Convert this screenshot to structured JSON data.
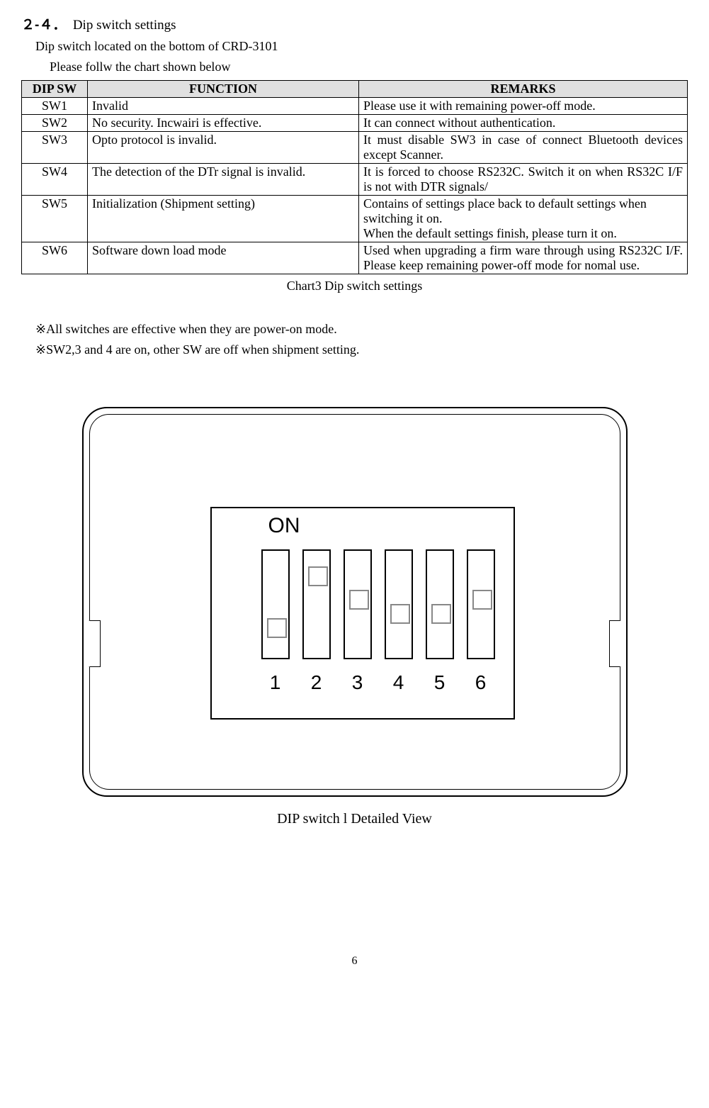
{
  "heading": {
    "number": "２-４．",
    "title": "Dip switch settings"
  },
  "intro_line1": "Dip switch   located on the bottom of CRD-3101",
  "intro_line2": "Please follw the chart shown below",
  "table": {
    "headers": {
      "sw": "DIP SW",
      "func": "FUNCTION",
      "rem": "REMARKS"
    },
    "rows": [
      {
        "sw": "SW1",
        "func": "Invalid",
        "rem": "Please use it with remaining power-off mode."
      },
      {
        "sw": "SW2",
        "func": "No security. Incwairi is effective.",
        "rem": "It can connect without authentication."
      },
      {
        "sw": "SW3",
        "func": "Opto protocol is invalid.",
        "rem": "It must disable SW3 in case of connect Bluetooth devices except Scanner."
      },
      {
        "sw": "SW4",
        "func": "The detection of the DTr signal is invalid.",
        "rem": "It is forced to choose RS232C. Switch it on when RS32C I/F is not with DTR signals/"
      },
      {
        "sw": "SW5",
        "func": "Initialization (Shipment setting)",
        "rem": "Contains of settings place back to default settings when switching it on.\nWhen the default settings finish, please turn it on."
      },
      {
        "sw": "SW6",
        "func": "Software down load mode",
        "rem": "Used when upgrading a firm ware through using RS232C I/F. Please keep remaining power-off mode for nomal use."
      }
    ]
  },
  "caption_table": "Chart3 Dip switch settings",
  "note1": "※All switches are effective when they are power-on mode.",
  "note2": "※SW2,3 and 4 are on, other SW are off when shipment setting.",
  "dip_diagram": {
    "on_label": "ON",
    "numbers": [
      "1",
      "2",
      "3",
      "4",
      "5",
      "6"
    ],
    "positions": [
      "off",
      "on",
      "mid-high",
      "mid-low",
      "mid-low",
      "mid-high"
    ]
  },
  "caption_figure": "DIP switch l Detailed View",
  "page_number": "6"
}
